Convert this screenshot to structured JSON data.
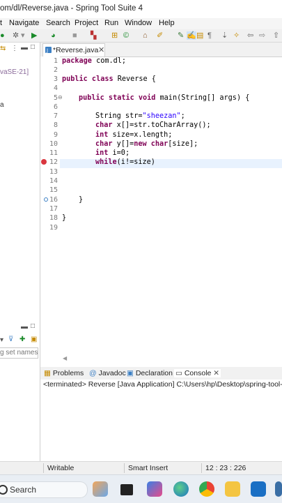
{
  "window": {
    "title": "om/dl/Reverse.java - Spring Tool Suite 4"
  },
  "menu": [
    "Navigate",
    "Search",
    "Project",
    "Run",
    "Window",
    "Help"
  ],
  "menu_partial": "t",
  "left_panel": {
    "jre_fragment": "vaSE-21]",
    "item_fragment": "a",
    "filter_placeholder": "g set names"
  },
  "editor": {
    "tab_label": "*Reverse.java",
    "lines": [
      {
        "n": "1"
      },
      {
        "n": "2"
      },
      {
        "n": "3"
      },
      {
        "n": "4"
      },
      {
        "n": "5"
      },
      {
        "n": "6"
      },
      {
        "n": "7"
      },
      {
        "n": "8"
      },
      {
        "n": "9"
      },
      {
        "n": "10"
      },
      {
        "n": "11"
      },
      {
        "n": "12"
      },
      {
        "n": "13"
      },
      {
        "n": "14"
      },
      {
        "n": "15"
      },
      {
        "n": "16"
      },
      {
        "n": "17"
      },
      {
        "n": "18"
      },
      {
        "n": "19"
      }
    ],
    "code": {
      "l1_kw": "package",
      "l1_rest": " com.dl;",
      "l3_kw": "public class",
      "l3_rest": " Reverse {",
      "l5_kw": "public static void",
      "l5_rest": " main(String[] args) {",
      "l7_a": "String str=",
      "l7_str": "\"sheezan\"",
      "l7_b": ";",
      "l8_kw": "char",
      "l8_rest": " x[]=str.toCharArray();",
      "l9_kw": "int",
      "l9_rest": " size=x.length;",
      "l10_kw1": "char",
      "l10_mid": " y[]=",
      "l10_kw2": "new char",
      "l10_rest": "[size];",
      "l11_kw": "int",
      "l11_rest": " i=0;",
      "l12_kw": "while",
      "l12_rest": "(i!=size)",
      "l16": "}",
      "l18": "}"
    }
  },
  "bottom_panel": {
    "tabs": [
      "Problems",
      "Javadoc",
      "Declaration",
      "Console"
    ],
    "console_text": "<terminated> Reverse [Java Application] C:\\Users\\hp\\Desktop\\spring-tool-sui"
  },
  "status": {
    "mode": "Writable",
    "insert": "Smart Insert",
    "position": "12 : 23 : 226"
  },
  "taskbar": {
    "search_label": "Search"
  },
  "colors": {
    "keyword": "#7f0055",
    "string": "#2a00ff",
    "current_line": "#e8f2fe",
    "error": "#d9363e"
  }
}
